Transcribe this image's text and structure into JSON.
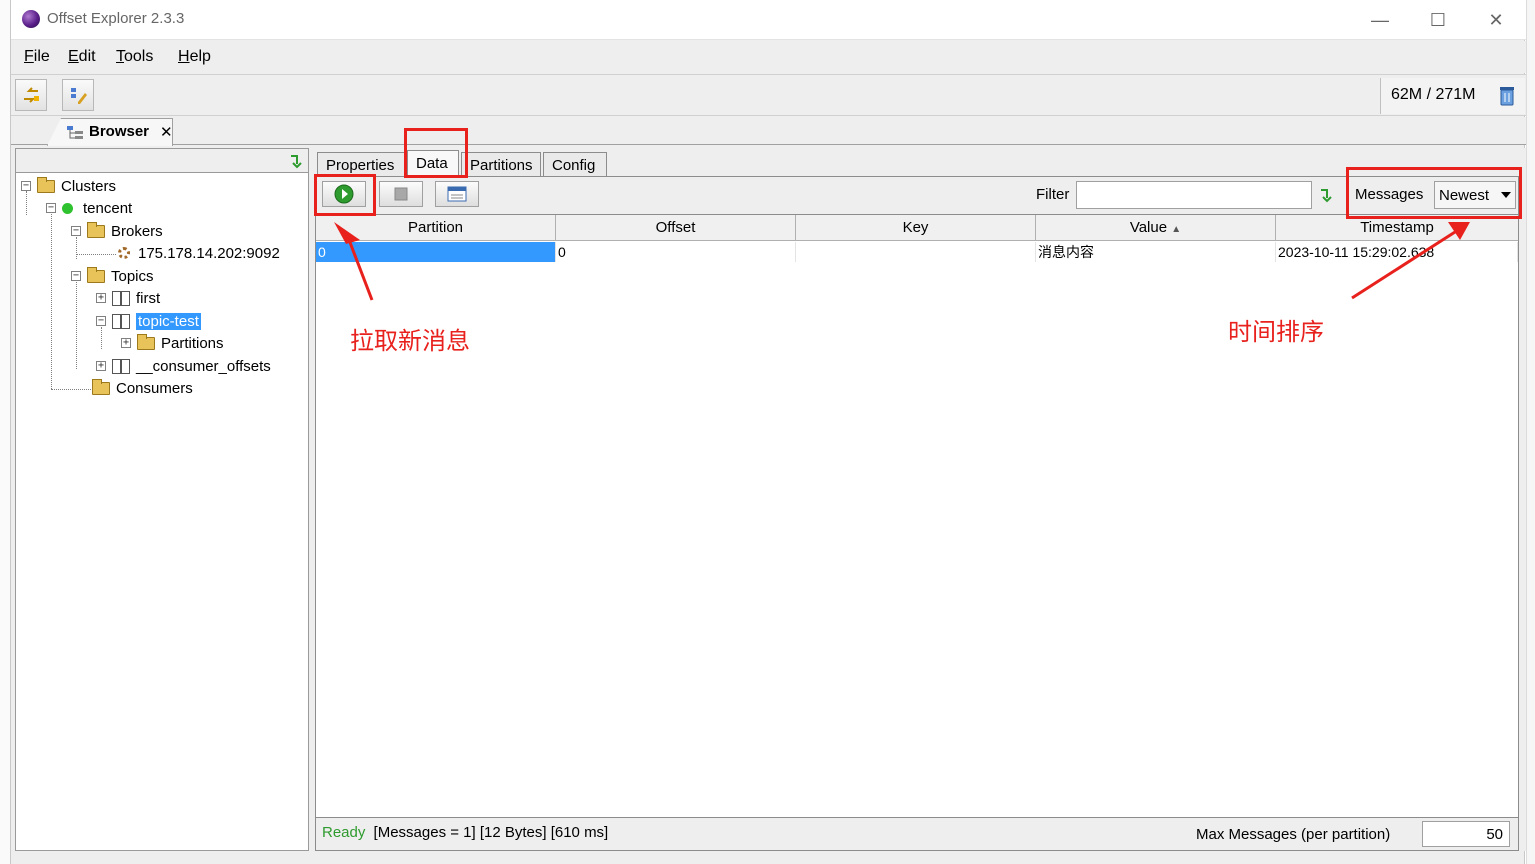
{
  "window": {
    "title": "Offset Explorer  2.3.3",
    "controls": {
      "minimize": "—",
      "maximize": "☐",
      "close": "✕"
    }
  },
  "menu": [
    {
      "key": "F",
      "rest": "ile"
    },
    {
      "key": "E",
      "rest": "dit"
    },
    {
      "key": "T",
      "rest": "ools"
    },
    {
      "key": "H",
      "rest": "elp"
    }
  ],
  "toolbar": {
    "memory": "62M / 271M",
    "icons": [
      "connect-icon",
      "edit-icon",
      "trash-icon"
    ]
  },
  "doc_tab": {
    "label": "Browser",
    "close": "✕"
  },
  "tree": {
    "clusters": "Clusters",
    "cluster": "tencent",
    "brokers": "Brokers",
    "broker": "175.178.14.202:9092",
    "topics": "Topics",
    "topic_first": "first",
    "topic_selected": "topic-test",
    "partitions": "Partitions",
    "topic_offsets": "__consumer_offsets",
    "consumers": "Consumers"
  },
  "tabs": [
    "Properties",
    "Data",
    "Partitions",
    "Config"
  ],
  "active_tab": "Data",
  "data_toolbar": {
    "filter_label": "Filter",
    "filter_value": "",
    "messages_label": "Messages",
    "messages_value": "Newest"
  },
  "table": {
    "columns": [
      "Partition",
      "Offset",
      "Key",
      "Value",
      "Timestamp"
    ],
    "sort_indicator": "▲",
    "rows": [
      {
        "partition": "0",
        "offset": "0",
        "key": "",
        "value": "消息内容",
        "timestamp": "2023-10-11 15:29:02.638"
      }
    ]
  },
  "status": {
    "ready": "Ready",
    "details": "[Messages = 1]  [12 Bytes]  [610 ms]",
    "max_label": "Max Messages (per partition)",
    "max_value": "50"
  },
  "annotations": {
    "fetch": "拉取新消息",
    "sort": "时间排序"
  },
  "colors": {
    "accent": "#3399ff",
    "annotation": "#e8211d",
    "ready": "#2e9b2e",
    "cluster_online": "#2fc22f"
  }
}
